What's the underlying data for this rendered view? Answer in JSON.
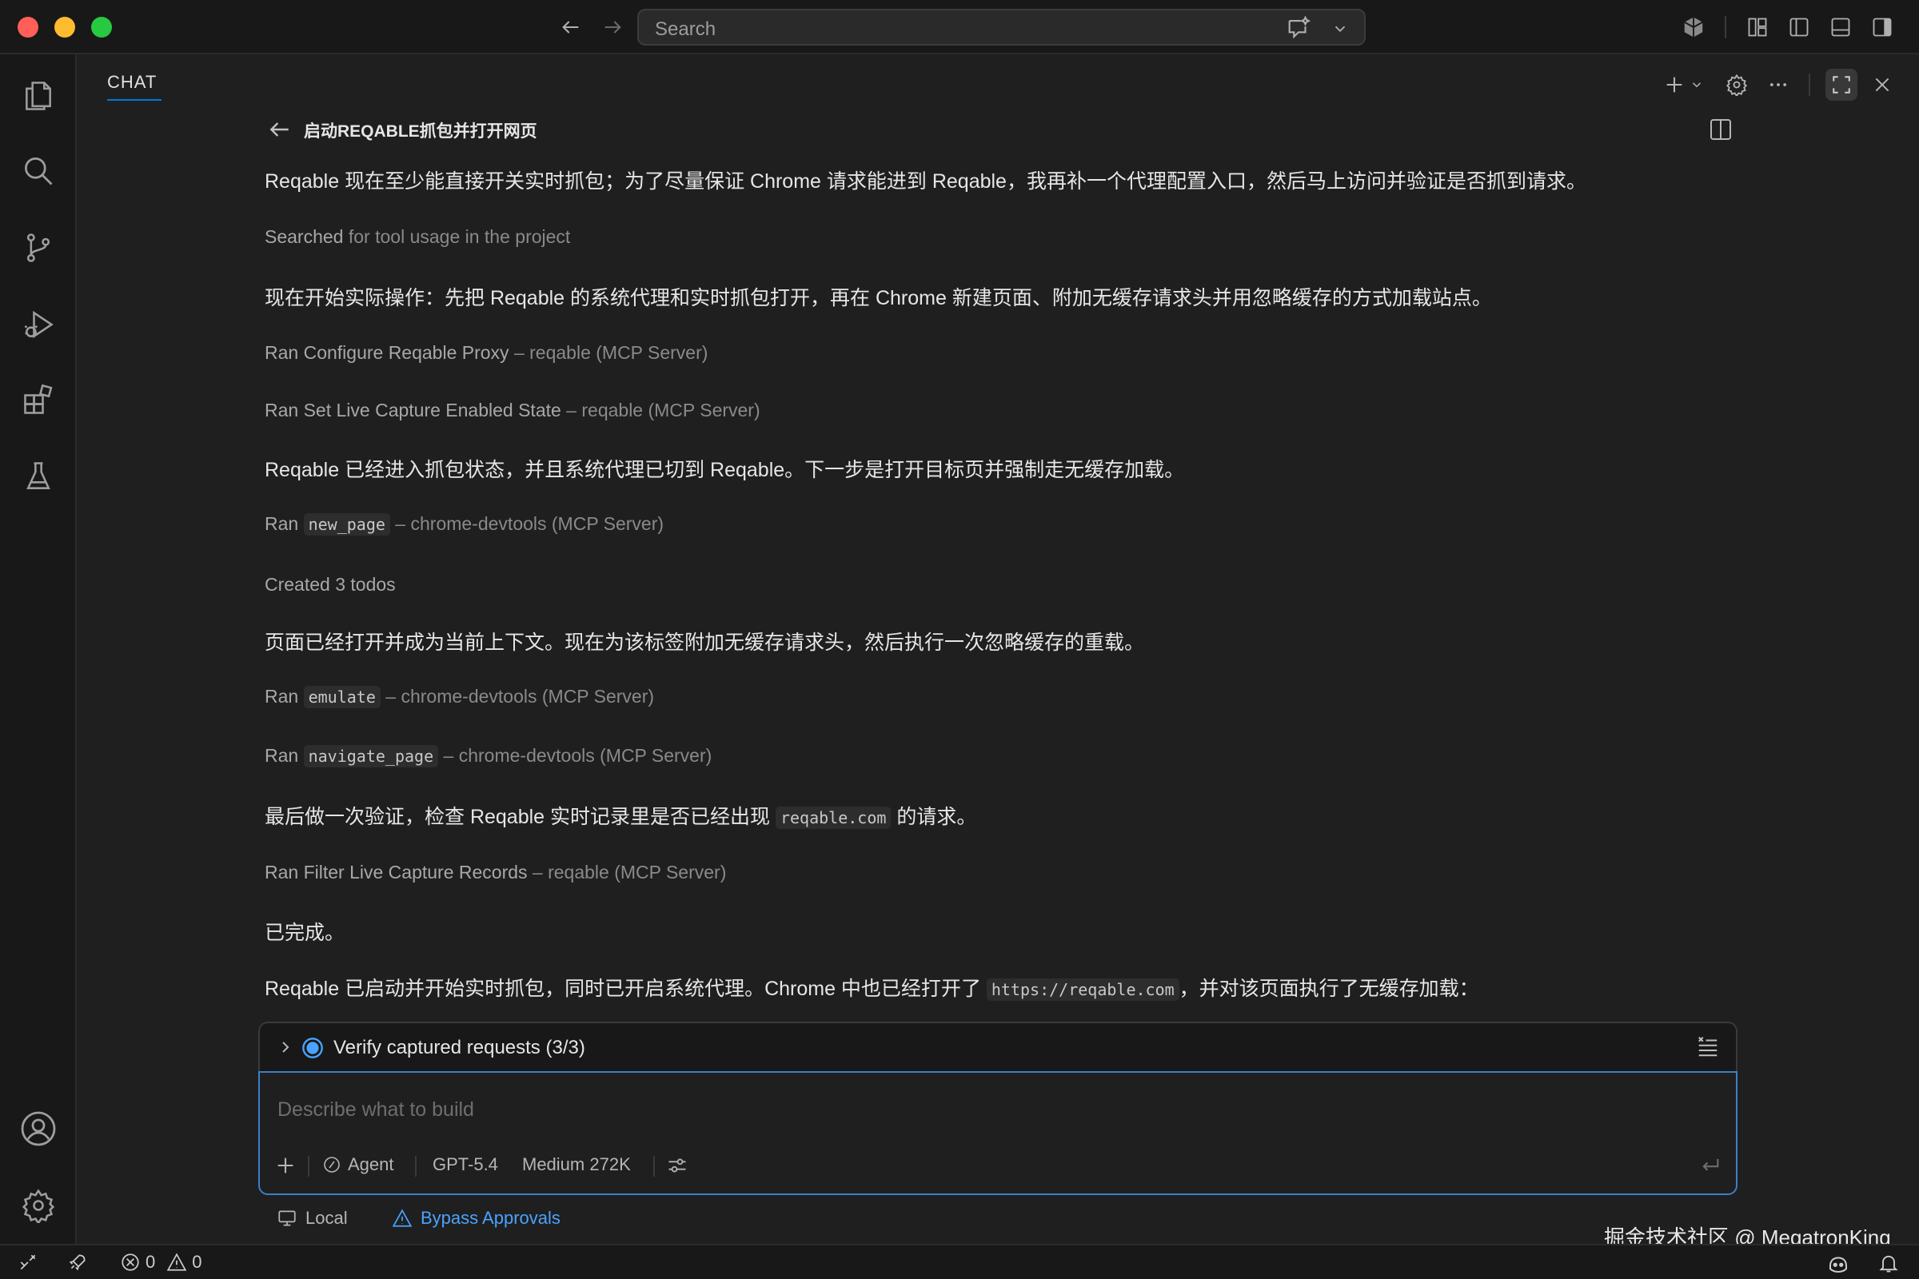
{
  "window": {
    "search_placeholder": "Search"
  },
  "chat": {
    "tab_label": "CHAT",
    "conversation_title": "启动REQABLE抓包并打开网页"
  },
  "messages": {
    "m1": "Reqable 现在至少能直接开关实时抓包；为了尽量保证 Chrome 请求能进到 Reqable，我再补一个代理配置入口，然后马上访问并验证是否抓到请求。",
    "m2_action": "Searched",
    "m2_detail": " for tool usage in the project",
    "m3": "现在开始实际操作：先把 Reqable 的系统代理和实时抓包打开，再在 Chrome 新建页面、附加无缓存请求头并用忽略缓存的方式加载站点。",
    "m4_action": "Ran Configure Reqable Proxy",
    "m4_server": " – reqable (MCP Server)",
    "m5_action": "Ran Set Live Capture Enabled State",
    "m5_server": " – reqable (MCP Server)",
    "m6": "Reqable 已经进入抓包状态，并且系统代理已切到 Reqable。下一步是打开目标页并强制走无缓存加载。",
    "m7_ran": "Ran ",
    "m7_code": "new_page",
    "m7_server": " – chrome-devtools (MCP Server)",
    "m8": "Created 3 todos",
    "m9": "页面已经打开并成为当前上下文。现在为该标签附加无缓存请求头，然后执行一次忽略缓存的重载。",
    "m10_ran": "Ran ",
    "m10_code": "emulate",
    "m10_server": " – chrome-devtools (MCP Server)",
    "m11_ran": "Ran ",
    "m11_code": "navigate_page",
    "m11_server": " – chrome-devtools (MCP Server)",
    "m12_pre": "最后做一次验证，检查 Reqable 实时记录里是否已经出现 ",
    "m12_code": "reqable.com",
    "m12_post": " 的请求。",
    "m13_action": "Ran Filter Live Capture Records",
    "m13_server": " – reqable (MCP Server)",
    "m14": "已完成。",
    "m15_pre": "Reqable 已启动并开始实时抓包，同时已开启系统代理。Chrome 中也已经打开了 ",
    "m15_code": "https://reqable.com",
    "m15_post": "，并对该页面执行了无缓存加载："
  },
  "todo": {
    "label": "Verify captured requests (3/3)"
  },
  "input": {
    "placeholder": "Describe what to build",
    "mode": "Agent",
    "model": "GPT-5.4",
    "effort": "Medium 272K"
  },
  "below": {
    "location": "Local",
    "approvals": "Bypass Approvals"
  },
  "statusbar": {
    "errors": "0",
    "warnings": "0"
  },
  "watermark": "掘金技术社区 @ MegatronKing",
  "colors": {
    "accent": "#0078d4",
    "input_border": "#3d7ec9",
    "link": "#4aa3ff"
  }
}
